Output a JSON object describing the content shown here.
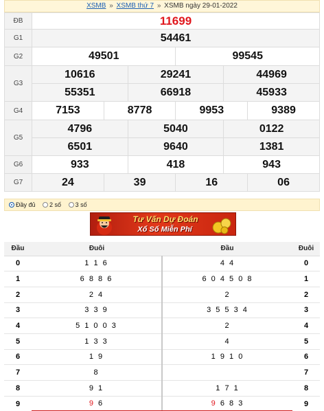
{
  "breadcrumb": {
    "link1": "XSMB",
    "sep1": "»",
    "link2": "XSMB thứ 7",
    "sep2": "»",
    "current": "XSMB ngày 29-01-2022"
  },
  "results": {
    "db": {
      "label": "ĐB",
      "values": [
        "11699"
      ]
    },
    "g1": {
      "label": "G1",
      "values": [
        "54461"
      ]
    },
    "g2": {
      "label": "G2",
      "values": [
        "49501",
        "99545"
      ]
    },
    "g3": {
      "label": "G3",
      "values": [
        "10616",
        "29241",
        "44969",
        "55351",
        "66918",
        "45933"
      ]
    },
    "g4": {
      "label": "G4",
      "values": [
        "7153",
        "8778",
        "9953",
        "9389"
      ]
    },
    "g5": {
      "label": "G5",
      "values": [
        "4796",
        "5040",
        "0122",
        "6501",
        "9640",
        "1381"
      ]
    },
    "g6": {
      "label": "G6",
      "values": [
        "933",
        "418",
        "943"
      ]
    },
    "g7": {
      "label": "G7",
      "values": [
        "24",
        "39",
        "16",
        "06"
      ]
    }
  },
  "display_options": {
    "full": "Đầy đủ",
    "two": "2 số",
    "three": "3 số",
    "selected": "full"
  },
  "banner": {
    "line1": "Tư Vấn Dự Đoán",
    "line2": "Xổ Số Miễn Phí"
  },
  "loto": {
    "headers": {
      "dau": "Đầu",
      "duoi": "Đuôi",
      "dau2": "Đầu",
      "duoi2": "Đuôi"
    },
    "rows": [
      {
        "k": "0",
        "left": "1 1 6",
        "right": "4 4",
        "k2": "0"
      },
      {
        "k": "1",
        "left": "6 8 8 6",
        "right": "6 0 4 5 0 8",
        "k2": "1"
      },
      {
        "k": "2",
        "left": "2 4",
        "right": "2",
        "k2": "2"
      },
      {
        "k": "3",
        "left": "3 3 9",
        "right": "3 5 5 3 4",
        "k2": "3"
      },
      {
        "k": "4",
        "left": "5 1 0 0 3",
        "right": "2",
        "k2": "4"
      },
      {
        "k": "5",
        "left": "1 3 3",
        "right": "4",
        "k2": "5"
      },
      {
        "k": "6",
        "left": "1 9",
        "right": "1 9 1 0",
        "k2": "6"
      },
      {
        "k": "7",
        "left": "8",
        "right": "",
        "k2": "7"
      },
      {
        "k": "8",
        "left": "9 1",
        "right": "1 7 1",
        "k2": "8"
      },
      {
        "k": "9",
        "left_red": "9",
        "left": " 6",
        "right_red": "9",
        "right": " 6 8 3",
        "k2": "9"
      }
    ]
  },
  "colors": {
    "special_prize": "#e0161c",
    "link": "#1a5fb4",
    "bar": "#fff3cf"
  }
}
